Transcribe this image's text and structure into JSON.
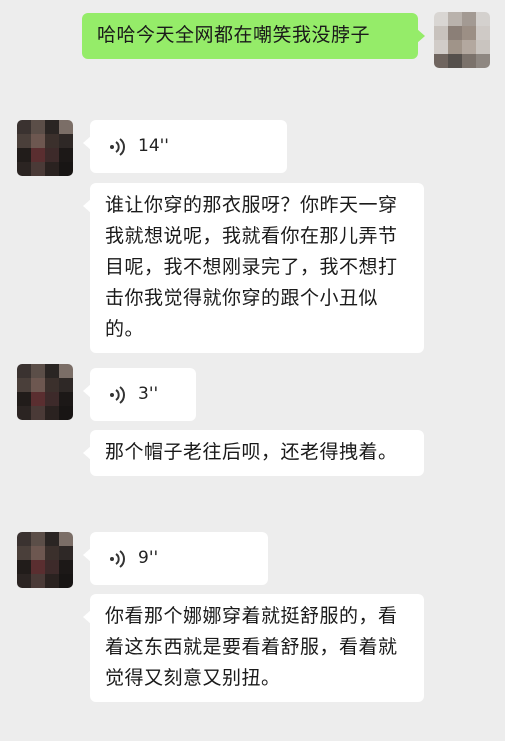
{
  "messages": [
    {
      "type": "text",
      "direction": "out",
      "text": "哈哈今天全网都在嘲笑我没脖子"
    },
    {
      "type": "voice",
      "direction": "in",
      "duration": "14''"
    },
    {
      "type": "text",
      "direction": "in",
      "text": "谁让你穿的那衣服呀？你昨天一穿我就想说呢，我就看你在那儿弄节目呢，我不想刚录完了，我不想打击你我觉得就你穿的跟个小丑似的。"
    },
    {
      "type": "voice",
      "direction": "in",
      "duration": "3''"
    },
    {
      "type": "text",
      "direction": "in",
      "text": "那个帽子老往后呗，还老得拽着。"
    },
    {
      "type": "voice",
      "direction": "in",
      "duration": "9''"
    },
    {
      "type": "text",
      "direction": "in",
      "text": "你看那个娜娜穿着就挺舒服的，看着这东西就是要看着舒服，看着就觉得又刻意又别扭。"
    }
  ],
  "colors": {
    "background": "#ededed",
    "outgoing_bubble": "#95ec69",
    "incoming_bubble": "#ffffff"
  },
  "icons": {
    "voice": "voice-wave-icon",
    "avatar": "pixelated-avatar"
  }
}
